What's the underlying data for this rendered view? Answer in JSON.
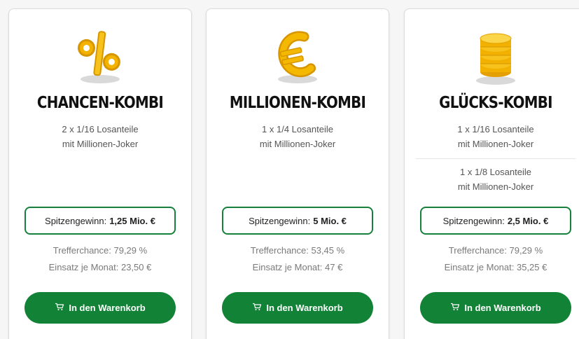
{
  "cards": [
    {
      "icon": "percent-icon",
      "title": "CHANCEN-KOMBI",
      "desc1_line1": "2 x 1/16 Losanteile",
      "desc1_line2": "mit Millionen-Joker",
      "prize_label": "Spitzengewinn:",
      "prize_value": "1,25 Mio. €",
      "chance": "Trefferchance: 79,29 %",
      "stake": "Einsatz je Monat: 23,50 €",
      "cart_label": "In den Warenkorb"
    },
    {
      "icon": "euro-icon",
      "title": "MILLIONEN-KOMBI",
      "desc1_line1": "1 x 1/4 Losanteile",
      "desc1_line2": "mit Millionen-Joker",
      "prize_label": "Spitzengewinn:",
      "prize_value": "5 Mio. €",
      "chance": "Trefferchance: 53,45 %",
      "stake": "Einsatz je Monat: 47 €",
      "cart_label": "In den Warenkorb"
    },
    {
      "icon": "coin-stack-icon",
      "title": "GLÜCKS-KOMBI",
      "desc1_line1": "1 x 1/16 Losanteile",
      "desc1_line2": "mit Millionen-Joker",
      "desc2_line1": "1 x 1/8 Losanteile",
      "desc2_line2": "mit Millionen-Joker",
      "prize_label": "Spitzengewinn:",
      "prize_value": "2,5 Mio. €",
      "chance": "Trefferchance: 79,29 %",
      "stake": "Einsatz je Monat: 35,25 €",
      "cart_label": "In den Warenkorb"
    }
  ],
  "colors": {
    "accent_green": "#128336",
    "gold": "#f5b800"
  }
}
